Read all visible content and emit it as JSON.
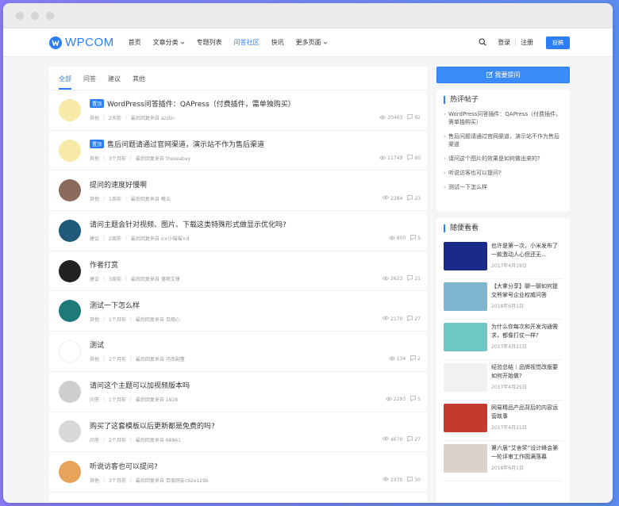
{
  "brand": {
    "name": "WPCOM"
  },
  "nav": [
    {
      "label": "首页",
      "dropdown": false,
      "active": false
    },
    {
      "label": "文章分类",
      "dropdown": true,
      "active": false
    },
    {
      "label": "专题列表",
      "dropdown": false,
      "active": false
    },
    {
      "label": "问答社区",
      "dropdown": false,
      "active": true
    },
    {
      "label": "快讯",
      "dropdown": false,
      "active": false
    },
    {
      "label": "更多页面",
      "dropdown": true,
      "active": false
    }
  ],
  "header": {
    "login": "登录",
    "register": "注册",
    "divider": "|",
    "post_button": "投稿"
  },
  "tabs": [
    "全部",
    "问答",
    "建议",
    "其他"
  ],
  "questions": [
    {
      "title": "WordPress问答插件：QAPress（付费插件，需单独购买）",
      "badge": "置顶",
      "category": "其他",
      "time": "2天前",
      "reply": "最后回复来自 azzlin",
      "views": "20463",
      "comments": "92",
      "avatar": "#f7e9a6"
    },
    {
      "title": "售后问题请通过官网渠道，演示站不作为售后渠道",
      "badge": "置顶",
      "category": "其他",
      "time": "3个月前",
      "reply": "最后回复来自 theseabay",
      "views": "11749",
      "comments": "60",
      "avatar": "#f7e9a6"
    },
    {
      "title": "提问的速度好慢啊",
      "badge": "",
      "category": "其他",
      "time": "1周前",
      "reply": "最后回复来自 曦五",
      "views": "2284",
      "comments": "23",
      "avatar": "#8a6a5a"
    },
    {
      "title": "请问主题会针对视频、图片、下载这类特殊形式做显示优化吗?",
      "badge": "",
      "category": "建议",
      "time": "2周前",
      "reply": "最后回复来自 o×小喵喵×d",
      "views": "800",
      "comments": "5",
      "avatar": "#1f5a7a"
    },
    {
      "title": "作者打赏",
      "badge": "",
      "category": "建议",
      "time": "3周前",
      "reply": "最后回复来自 落雨文锋",
      "views": "2623",
      "comments": "21",
      "avatar": "#222222"
    },
    {
      "title": "测试一下怎么样",
      "badge": "",
      "category": "其他",
      "time": "1个月前",
      "reply": "最后回复来自 且随心",
      "views": "2170",
      "comments": "27",
      "avatar": "#1e7a7a"
    },
    {
      "title": "测试",
      "badge": "",
      "category": "其他",
      "time": "1个月前",
      "reply": "最后回复来自 河南副董",
      "views": "134",
      "comments": "2",
      "avatar": "#ffffff"
    },
    {
      "title": "请问这个主题可以加视频版本吗",
      "badge": "",
      "category": "问答",
      "time": "1个月前",
      "reply": "最后回复来自 1928",
      "views": "2293",
      "comments": "5",
      "avatar": "#cfcfcf"
    },
    {
      "title": "购买了这套模板以后更新都是免费的吗?",
      "badge": "",
      "category": "问答",
      "time": "2个月前",
      "reply": "最后回复来自 68861",
      "views": "4670",
      "comments": "27",
      "avatar": "#d8d8d8"
    },
    {
      "title": "听说访客也可以提问?",
      "badge": "",
      "category": "其他",
      "time": "3个月前",
      "reply": "最后回复来自 百度网友c92e129b",
      "views": "2370",
      "comments": "30",
      "avatar": "#e8a35a"
    }
  ],
  "sidebar": {
    "ask_button": "我要提问",
    "hot_title": "热评帖子",
    "hot_posts": [
      "WordPress问答插件：QAPress（付费插件，需单独购买）",
      "售后问题请通过官网渠道，演示站不作为售后渠道",
      "请问这个图片的效果是如何做出来的?",
      "听说访客也可以提问?",
      "测试一下怎么样"
    ],
    "random_title": "随便看看",
    "random_posts": [
      {
        "title": "也许是第一次，小米发布了一款激动人心但还无…",
        "date": "2017年4月19日",
        "thumb": "#1a2a8a"
      },
      {
        "title": "【大拿分享】聊一聊如何提交熊掌号企业权威问答",
        "date": "2018年6月1日",
        "thumb": "#7fb5cf"
      },
      {
        "title": "为什么你每次和开发沟通需求，都像打仗一样?",
        "date": "2017年4月21日",
        "thumb": "#6fc7c4"
      },
      {
        "title": "经验总结｜品牌视觉改版要如何开始做?",
        "date": "2017年4月25日",
        "thumb": "#f1f1f1"
      },
      {
        "title": "网易精品产品背后的内容运营故事",
        "date": "2017年4月21日",
        "thumb": "#c43a2e"
      },
      {
        "title": "第六届“艾舍奖”设计峰会第一轮评审工作圆满落幕",
        "date": "2018年6月1日",
        "thumb": "#d9d3cc"
      }
    ]
  }
}
